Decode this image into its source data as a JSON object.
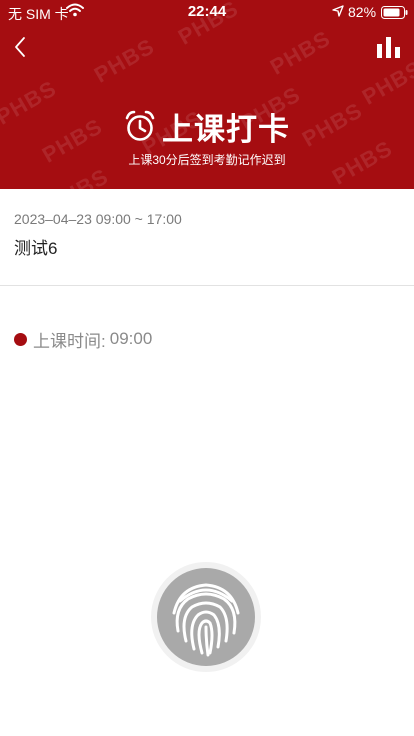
{
  "status_bar": {
    "carrier": "无 SIM 卡",
    "time": "22:44",
    "battery": "82%"
  },
  "header": {
    "title": "上课打卡",
    "subtitle": "上课30分后签到考勤记作迟到",
    "watermark": "PHBS",
    "background_color": "#a50d11"
  },
  "session": {
    "datetime": "2023–04–23 09:00 ~ 17:00",
    "name": "测试6"
  },
  "class_time": {
    "label": "上课时间:",
    "value": "09:00"
  },
  "icons": {
    "back": "back-chevron-icon",
    "stats": "bar-chart-icon",
    "alarm": "alarm-clock-icon",
    "fingerprint": "fingerprint-icon"
  }
}
